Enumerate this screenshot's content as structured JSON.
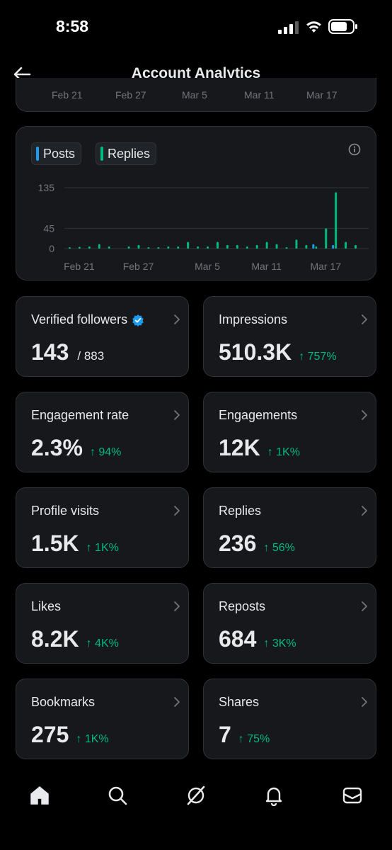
{
  "status_bar": {
    "time": "8:58"
  },
  "header": {
    "title": "Account Analytics"
  },
  "top_chart": {
    "x_labels": [
      "Feb 21",
      "Feb 27",
      "Mar 5",
      "Mar 11",
      "Mar 17"
    ]
  },
  "chart_data": {
    "type": "bar",
    "legend": [
      "Posts",
      "Replies"
    ],
    "colors": {
      "posts": "#1d9bf0",
      "replies": "#00ba7c"
    },
    "x_tick_labels": [
      "Feb 21",
      "Feb 27",
      "Mar 5",
      "Mar 11",
      "Mar 17"
    ],
    "y_ticks": [
      0,
      45,
      135
    ],
    "ylim": [
      0,
      135
    ],
    "days": [
      "Feb 20",
      "Feb 21",
      "Feb 22",
      "Feb 23",
      "Feb 24",
      "Feb 25",
      "Feb 26",
      "Feb 27",
      "Feb 28",
      "Feb 29",
      "Mar 1",
      "Mar 2",
      "Mar 3",
      "Mar 4",
      "Mar 5",
      "Mar 6",
      "Mar 7",
      "Mar 8",
      "Mar 9",
      "Mar 10",
      "Mar 11",
      "Mar 12",
      "Mar 13",
      "Mar 14",
      "Mar 15",
      "Mar 16",
      "Mar 17",
      "Mar 18",
      "Mar 19",
      "Mar 20"
    ],
    "series": [
      {
        "name": "Replies",
        "values": [
          2,
          4,
          5,
          10,
          5,
          0,
          5,
          8,
          3,
          3,
          5,
          5,
          15,
          5,
          5,
          15,
          8,
          8,
          5,
          8,
          15,
          10,
          3,
          20,
          8,
          5,
          45,
          125,
          15,
          8
        ]
      },
      {
        "name": "Posts",
        "values": [
          0,
          0,
          0,
          0,
          0,
          0,
          0,
          0,
          0,
          0,
          0,
          0,
          0,
          0,
          0,
          0,
          0,
          0,
          0,
          0,
          0,
          0,
          0,
          0,
          0,
          10,
          0,
          8,
          0,
          0
        ]
      }
    ]
  },
  "stats": [
    {
      "label": "Verified followers",
      "value": "143",
      "total": "/ 883",
      "change": "",
      "verified": true
    },
    {
      "label": "Impressions",
      "value": "510.3K",
      "total": "",
      "change": "↑ 757%"
    },
    {
      "label": "Engagement rate",
      "value": "2.3%",
      "total": "",
      "change": "↑ 94%"
    },
    {
      "label": "Engagements",
      "value": "12K",
      "total": "",
      "change": "↑ 1K%"
    },
    {
      "label": "Profile visits",
      "value": "1.5K",
      "total": "",
      "change": "↑ 1K%"
    },
    {
      "label": "Replies",
      "value": "236",
      "total": "",
      "change": "↑ 56%"
    },
    {
      "label": "Likes",
      "value": "8.2K",
      "total": "",
      "change": "↑ 4K%"
    },
    {
      "label": "Reposts",
      "value": "684",
      "total": "",
      "change": "↑ 3K%"
    },
    {
      "label": "Bookmarks",
      "value": "275",
      "total": "",
      "change": "↑ 1K%"
    },
    {
      "label": "Shares",
      "value": "7",
      "total": "",
      "change": "↑ 75%"
    }
  ],
  "nav": [
    "home-icon",
    "search-icon",
    "grok-icon",
    "notifications-icon",
    "messages-icon"
  ]
}
